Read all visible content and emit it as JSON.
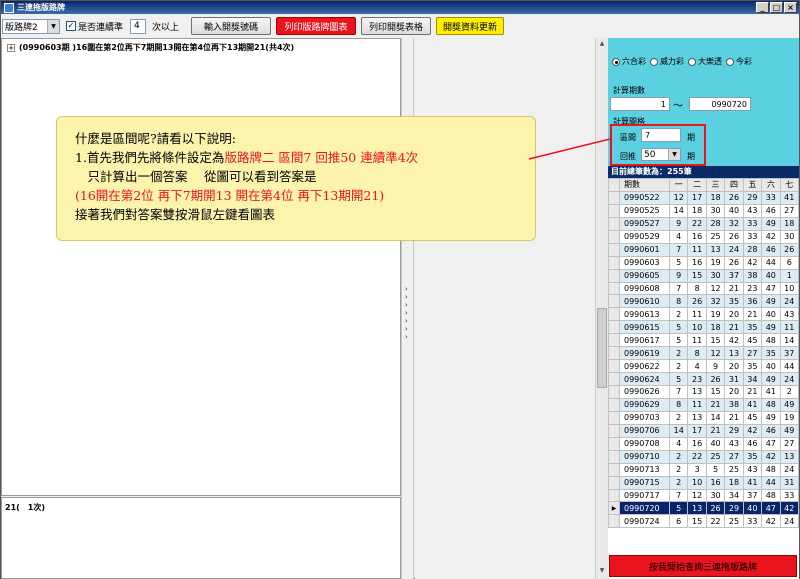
{
  "window": {
    "title": "三連拖版路牌"
  },
  "toolbar": {
    "board_select": "版路牌2",
    "consecutive_label": "是否連續準",
    "consecutive_value": "4",
    "times_label": "次以上",
    "btn_input": "輸入開獎號碼",
    "btn_print_chart": "列印版路牌圖表",
    "btn_print_table": "列印開獎表格",
    "btn_update": "開獎資料更新"
  },
  "tree": {
    "node_text": "(0990603期 )16圍在第2位再下7期開13開在第4位再下13期開21(共4次)"
  },
  "bottom": {
    "text": "21(　1次)"
  },
  "lottery": {
    "options": [
      "六合彩",
      "威力彩",
      "大樂透",
      "今彩"
    ],
    "selected": "六合彩"
  },
  "calc": {
    "period_label": "計算期數",
    "period_from": "1",
    "tilde": "〜",
    "period_to": "0990720",
    "interval_label": "計算間格",
    "range_label": "區間",
    "range_value": "7",
    "range_unit": "期",
    "back_label": "回推",
    "back_value": "50",
    "back_unit": "期"
  },
  "table": {
    "title": "目前總筆數為：255筆",
    "headers": [
      "期數",
      "一",
      "二",
      "三",
      "四",
      "五",
      "六",
      "七"
    ],
    "rows": [
      [
        "0990522",
        "12",
        "17",
        "18",
        "26",
        "29",
        "33",
        "41"
      ],
      [
        "0990525",
        "14",
        "18",
        "30",
        "40",
        "43",
        "46",
        "27"
      ],
      [
        "0990527",
        "9",
        "22",
        "28",
        "32",
        "33",
        "49",
        "18"
      ],
      [
        "0990529",
        "4",
        "16",
        "25",
        "26",
        "33",
        "42",
        "30"
      ],
      [
        "0990601",
        "7",
        "11",
        "13",
        "24",
        "28",
        "46",
        "26"
      ],
      [
        "0990603",
        "5",
        "16",
        "19",
        "26",
        "42",
        "44",
        "6"
      ],
      [
        "0990605",
        "9",
        "15",
        "30",
        "37",
        "38",
        "40",
        "1"
      ],
      [
        "0990608",
        "7",
        "8",
        "12",
        "21",
        "23",
        "47",
        "10"
      ],
      [
        "0990610",
        "8",
        "26",
        "32",
        "35",
        "36",
        "49",
        "24"
      ],
      [
        "0990613",
        "2",
        "11",
        "19",
        "20",
        "21",
        "40",
        "43"
      ],
      [
        "0990615",
        "5",
        "10",
        "18",
        "21",
        "35",
        "49",
        "11"
      ],
      [
        "0990617",
        "5",
        "11",
        "15",
        "42",
        "45",
        "48",
        "14"
      ],
      [
        "0990619",
        "2",
        "8",
        "12",
        "13",
        "27",
        "35",
        "37"
      ],
      [
        "0990622",
        "2",
        "4",
        "9",
        "20",
        "35",
        "40",
        "44"
      ],
      [
        "0990624",
        "5",
        "23",
        "26",
        "31",
        "34",
        "49",
        "24"
      ],
      [
        "0990626",
        "7",
        "13",
        "15",
        "20",
        "21",
        "41",
        "2"
      ],
      [
        "0990629",
        "8",
        "11",
        "21",
        "38",
        "41",
        "48",
        "49"
      ],
      [
        "0990703",
        "2",
        "13",
        "14",
        "21",
        "45",
        "49",
        "19"
      ],
      [
        "0990706",
        "14",
        "17",
        "21",
        "29",
        "42",
        "46",
        "49"
      ],
      [
        "0990708",
        "4",
        "16",
        "40",
        "43",
        "46",
        "47",
        "27"
      ],
      [
        "0990710",
        "2",
        "22",
        "25",
        "27",
        "35",
        "42",
        "13"
      ],
      [
        "0990713",
        "2",
        "3",
        "5",
        "25",
        "43",
        "48",
        "24"
      ],
      [
        "0990715",
        "2",
        "10",
        "16",
        "18",
        "41",
        "44",
        "31"
      ],
      [
        "0990717",
        "7",
        "12",
        "30",
        "34",
        "37",
        "48",
        "33"
      ],
      [
        "0990720",
        "5",
        "13",
        "26",
        "29",
        "40",
        "47",
        "42"
      ],
      [
        "0990724",
        "6",
        "15",
        "22",
        "25",
        "33",
        "42",
        "24"
      ]
    ],
    "selected_row": 24,
    "row_marker": "▶"
  },
  "bigbutton": "按我開始查詢三連拖版路牌",
  "callout": {
    "line1": "什麼是區間呢?請看以下說明:",
    "line2a": "1.首先我們先將條件設定為",
    "line2b": "版路牌二 區間7 回推50 連續準4次",
    "line3": "　只計算出一個答案　 從圖可以看到答案是",
    "line4": "(16開在第2位 再下7期開13 開在第4位 再下13期開21)",
    "line5": "接著我們對答案雙按滑鼠左鍵看圖表"
  },
  "colors": {
    "accent_red": "#e8141e",
    "panel_cyan": "#5bd0e0",
    "callout_bg": "#fcf3ad",
    "header_navy": "#0a2a66"
  }
}
